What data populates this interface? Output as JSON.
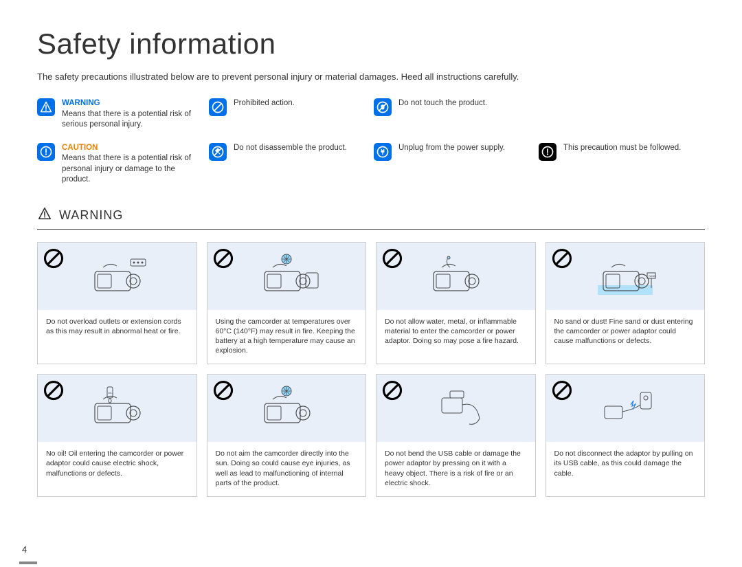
{
  "title": "Safety information",
  "intro": "The safety precautions illustrated below are to prevent personal injury or material damages. Heed all instructions carefully.",
  "legend": {
    "warning": {
      "title": "WARNING",
      "body": "Means that there is a potential risk of serious personal injury."
    },
    "caution": {
      "title": "CAUTION",
      "body": "Means that there is a potential risk of personal injury or damage to the product."
    },
    "prohibited": "Prohibited action.",
    "no_disassemble": "Do not disassemble the product.",
    "no_touch": "Do not touch the product.",
    "unplug": "Unplug from the power supply.",
    "must_follow": "This precaution must be followed."
  },
  "section_heading": "WARNING",
  "cards": [
    "Do not overload outlets or extension cords as this may result in abnormal heat or fire.",
    "Using the camcorder at temperatures over 60°C (140°F) may result in fire. Keeping the battery at a high temperature may cause an explosion.",
    "Do not allow water, metal, or inflammable material to enter the camcorder or power adaptor. Doing so may pose a fire hazard.",
    "No sand or dust! Fine sand or dust entering the camcorder or power adaptor could cause malfunctions or defects.",
    "No oil! Oil entering the camcorder or power adaptor could cause electric shock, malfunctions or defects.",
    "Do not aim the camcorder directly into the sun. Doing so could cause eye injuries, as well as lead to malfunctioning of internal parts of the product.",
    "Do not bend the USB cable or damage the power adaptor by pressing on it with a heavy object. There is a risk of fire or an electric shock.",
    "Do not disconnect the adaptor by pulling on its USB cable, as this could damage the cable."
  ],
  "page_number": "4"
}
